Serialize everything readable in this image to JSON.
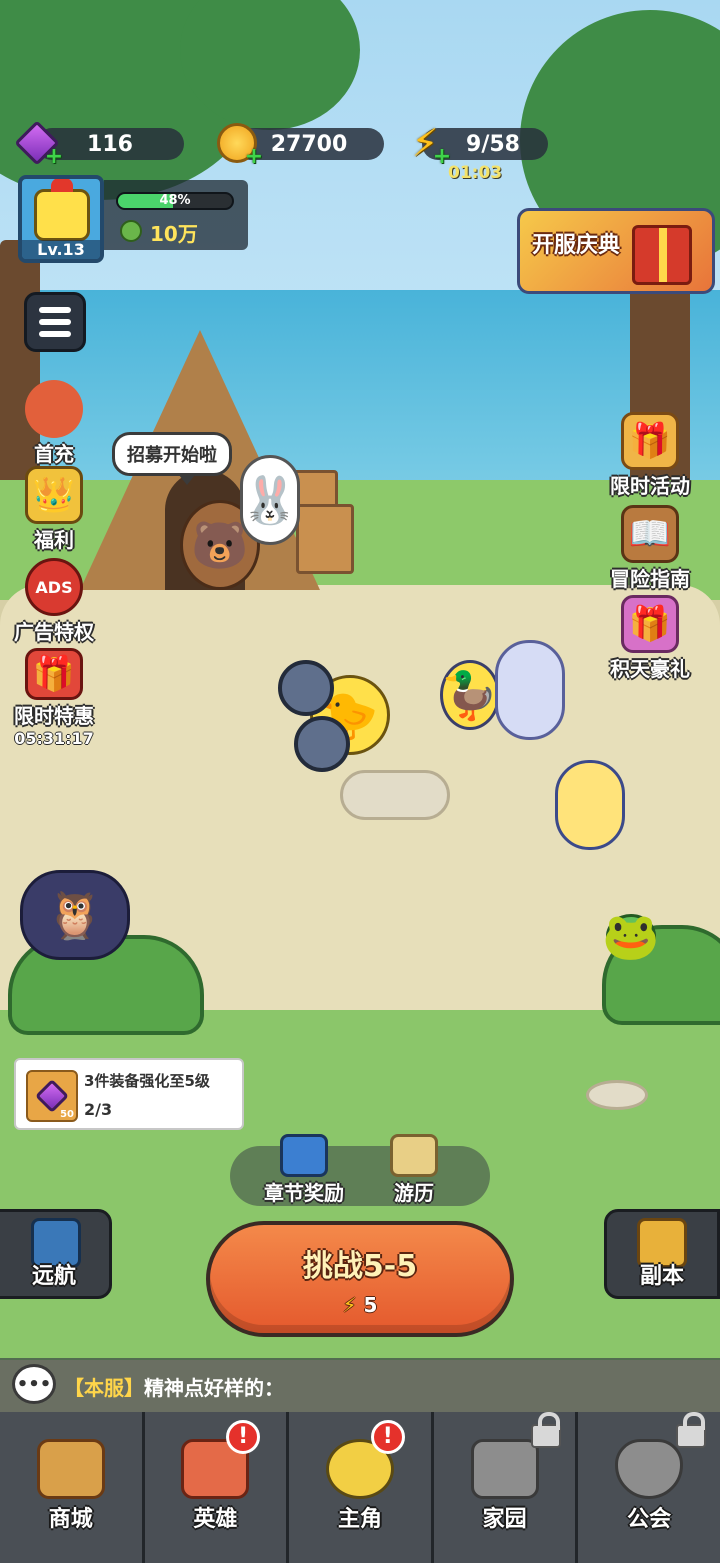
{
  "resources": {
    "gems": "116",
    "coins": "27700",
    "energy": "9/58",
    "energy_timer": "01:03"
  },
  "player": {
    "level": "Lv.13",
    "exp_percent": "48%",
    "exp_fraction": 0.48,
    "power": "10万"
  },
  "left_menu": [
    {
      "label": "首充",
      "icon": "heroine-portrait-icon"
    },
    {
      "label": "福利",
      "icon": "crown-card-icon"
    },
    {
      "label": "广告特权",
      "icon": "ads-icon"
    },
    {
      "label": "限时特惠",
      "icon": "gift-box-icon",
      "timer": "05:31:17"
    }
  ],
  "right_menu": {
    "banner": "开服庆典",
    "items": [
      {
        "label": "限时活动",
        "icon": "gift-pile-icon"
      },
      {
        "label": "冒险指南",
        "icon": "guide-book-icon"
      },
      {
        "label": "积天豪礼",
        "icon": "fairy-gift-icon"
      }
    ]
  },
  "speech_bubble": "招募开始啦",
  "quest": {
    "title": "3件装备强化至5级",
    "progress": "2/3",
    "reward_count": "50"
  },
  "mid_actions": {
    "chapter_reward": "章节奖励",
    "travel": "游历"
  },
  "voyage_label": "远航",
  "dungeon_label": "副本",
  "challenge": {
    "label": "挑战5-5",
    "cost": "5"
  },
  "chat": {
    "channel": "【本服】",
    "message": "精神点好样的："
  },
  "nav": [
    {
      "label": "商城",
      "alert": false,
      "locked": false,
      "color": "#d9a04a"
    },
    {
      "label": "英雄",
      "alert": true,
      "locked": false,
      "color": "#e46a48"
    },
    {
      "label": "主角",
      "alert": true,
      "locked": false,
      "color": "#f2cf44"
    },
    {
      "label": "家园",
      "alert": false,
      "locked": true,
      "color": "#8d8d8d"
    },
    {
      "label": "公会",
      "alert": false,
      "locked": true,
      "color": "#8d8d8d"
    }
  ],
  "colors": {
    "challenge": "#e4592d",
    "exp_bar": "#4bd36b",
    "alert": "#e5312b"
  }
}
